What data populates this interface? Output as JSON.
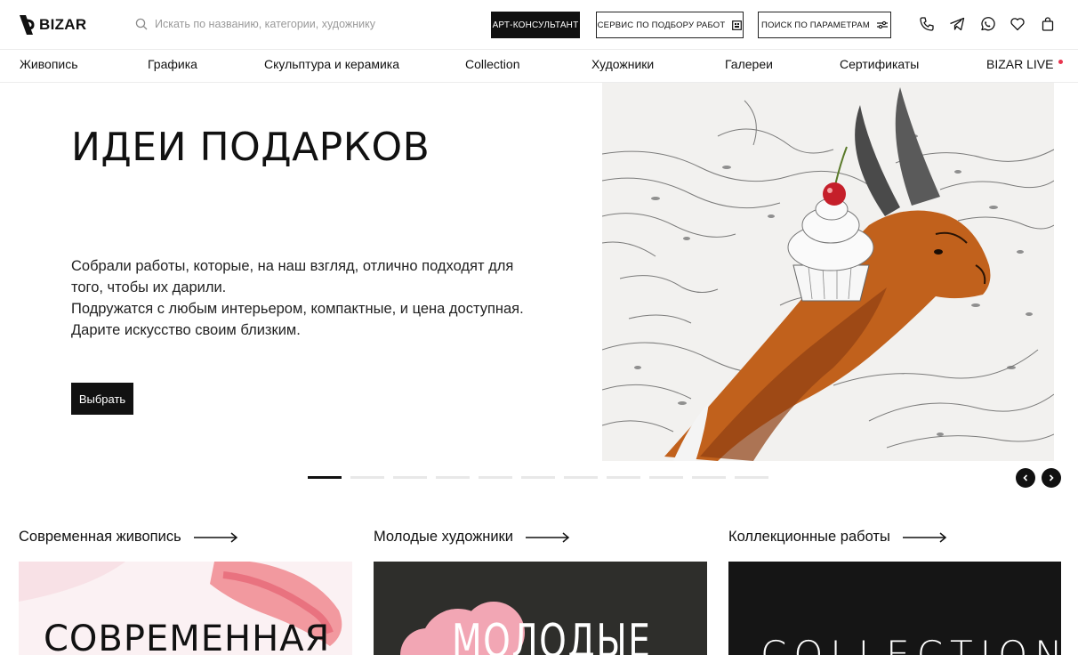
{
  "header": {
    "logo": "BIZAR",
    "search_placeholder": "Искать по названию, категории, художнику",
    "btn_consultant": "АРТ-КОНСУЛЬТАНТ",
    "btn_service": "СЕРВИС ПО ПОДБОРУ РАБОТ",
    "btn_params": "ПОИСК ПО ПАРАМЕТРАМ",
    "icons": [
      "phone-icon",
      "telegram-icon",
      "whatsapp-icon",
      "heart-icon",
      "bag-icon"
    ]
  },
  "nav": {
    "items": [
      "Живопись",
      "Графика",
      "Скульптура и керамика",
      "Collection",
      "Художники",
      "Галереи",
      "Сертификаты",
      "BIZAR LIVE"
    ]
  },
  "hero": {
    "title": "ИДЕИ ПОДАРКОВ",
    "paragraph1": "Собрали работы, которые, на наш взгляд, отлично подходят для того, чтобы их дарили.",
    "paragraph2": "Подружатся с любым интерьером, компактные, и цена доступная. Дарите искусство своим близким.",
    "button": "Выбрать"
  },
  "slider": {
    "total_slides": 11,
    "active_slide": 1
  },
  "categories": [
    {
      "title": "Современная живопись",
      "card_text": "СОВРЕМЕННАЯ"
    },
    {
      "title": "Молодые художники",
      "card_text": "МОЛОДЫЕ"
    },
    {
      "title": "Коллекционные работы",
      "card_text": "COLLECTION"
    }
  ],
  "colors": {
    "text": "#111111",
    "accent_live": "#e8344e",
    "button_dark": "#111111"
  }
}
